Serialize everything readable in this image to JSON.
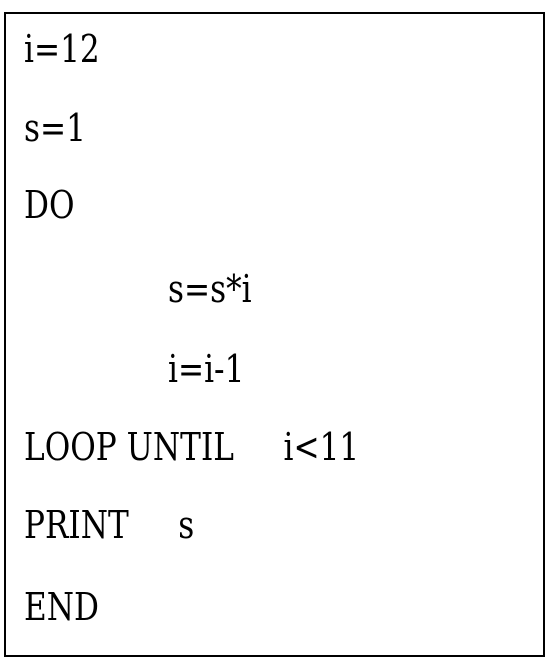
{
  "program": {
    "lines": [
      "i=12",
      "s=1",
      "DO",
      "s=s*i",
      "i=i-1",
      "LOOP UNTIL     i<11",
      "PRINT     s",
      "END"
    ]
  },
  "colors": {
    "text": "#000000",
    "border": "#000000",
    "background": "#ffffff"
  }
}
